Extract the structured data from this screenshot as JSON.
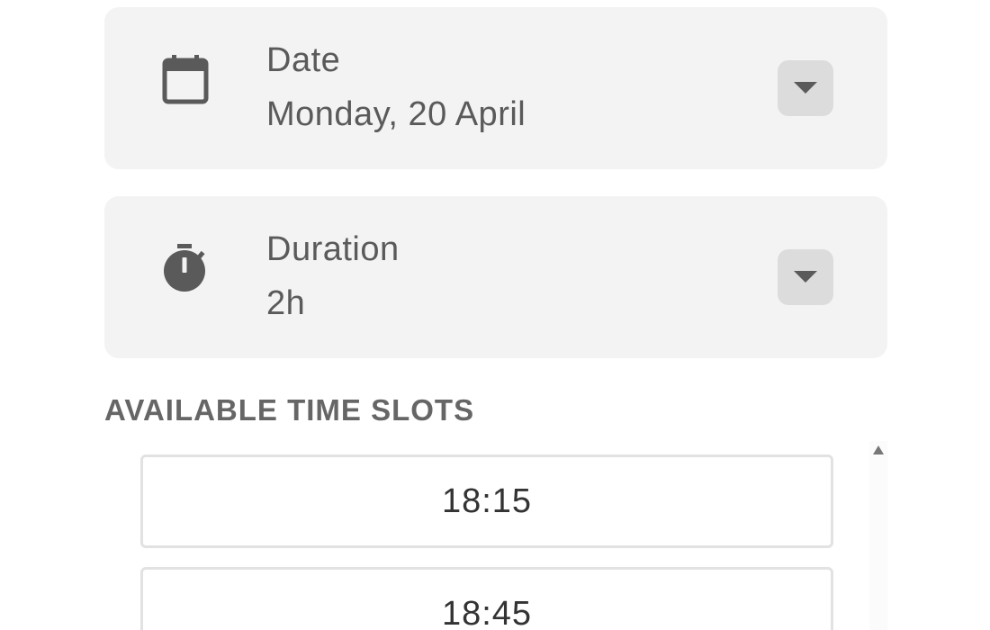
{
  "date_card": {
    "icon": "calendar-icon",
    "label": "Date",
    "value": "Monday, 20 April"
  },
  "duration_card": {
    "icon": "stopwatch-icon",
    "label": "Duration",
    "value": "2h"
  },
  "time_slots": {
    "title": "AVAILABLE TIME SLOTS",
    "slots": [
      "18:15",
      "18:45"
    ]
  },
  "colors": {
    "card_background": "#f3f3f3",
    "dropdown_background": "#dcdcdc",
    "icon": "#5a5a5a",
    "slot_border": "#e2e2e2"
  }
}
